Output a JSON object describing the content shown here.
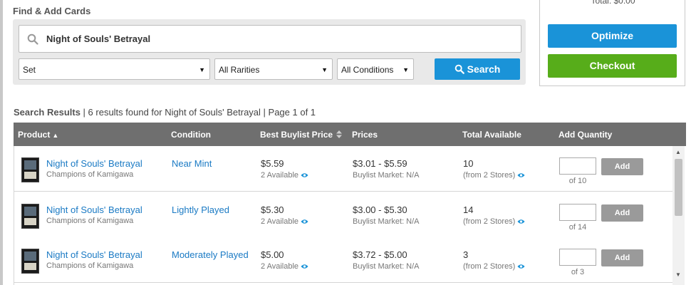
{
  "section_title": "Find & Add Cards",
  "search": {
    "query": "Night of Souls' Betrayal",
    "set_label": "Set",
    "rarity_label": "All Rarities",
    "condition_label": "All Conditions",
    "button_label": "Search"
  },
  "cart": {
    "total": "Total: $0.00",
    "optimize_label": "Optimize",
    "checkout_label": "Checkout"
  },
  "results": {
    "label": "Search Results",
    "found": " | 6 results found for Night of Souls' Betrayal | Page 1 of 1"
  },
  "columns": {
    "product": "Product",
    "condition": "Condition",
    "best_buylist": "Best Buylist Price",
    "prices": "Prices",
    "total_available": "Total Available",
    "add_quantity": "Add Quantity"
  },
  "rows": [
    {
      "name": "Night of Souls' Betrayal",
      "set": "Champions of Kamigawa",
      "condition": "Near Mint",
      "buylist_price": "$5.59",
      "buylist_available": "2 Available",
      "price_range": "$3.01 - $5.59",
      "buylist_market": "Buylist Market: N/A",
      "total": "10",
      "stores": "(from 2 Stores)",
      "qty_of": "of 10",
      "add_label": "Add"
    },
    {
      "name": "Night of Souls' Betrayal",
      "set": "Champions of Kamigawa",
      "condition": "Lightly Played",
      "buylist_price": "$5.30",
      "buylist_available": "2 Available",
      "price_range": "$3.00 - $5.30",
      "buylist_market": "Buylist Market: N/A",
      "total": "14",
      "stores": "(from 2 Stores)",
      "qty_of": "of 14",
      "add_label": "Add"
    },
    {
      "name": "Night of Souls' Betrayal",
      "set": "Champions of Kamigawa",
      "condition": "Moderately Played",
      "buylist_price": "$5.00",
      "buylist_available": "2 Available",
      "price_range": "$3.72 - $5.00",
      "buylist_market": "Buylist Market: N/A",
      "total": "3",
      "stores": "(from 2 Stores)",
      "qty_of": "of 3",
      "add_label": "Add"
    }
  ],
  "colors": {
    "primary_blue": "#1a93d8",
    "checkout_green": "#57ad1a",
    "link_blue": "#1a7ac4",
    "header_gray": "#6f6f6f"
  },
  "icons": {
    "search": "magnifier-icon",
    "availability": "eye-icon",
    "sort_asc": "sort-up-icon",
    "sort_both": "sort-both-icon"
  }
}
